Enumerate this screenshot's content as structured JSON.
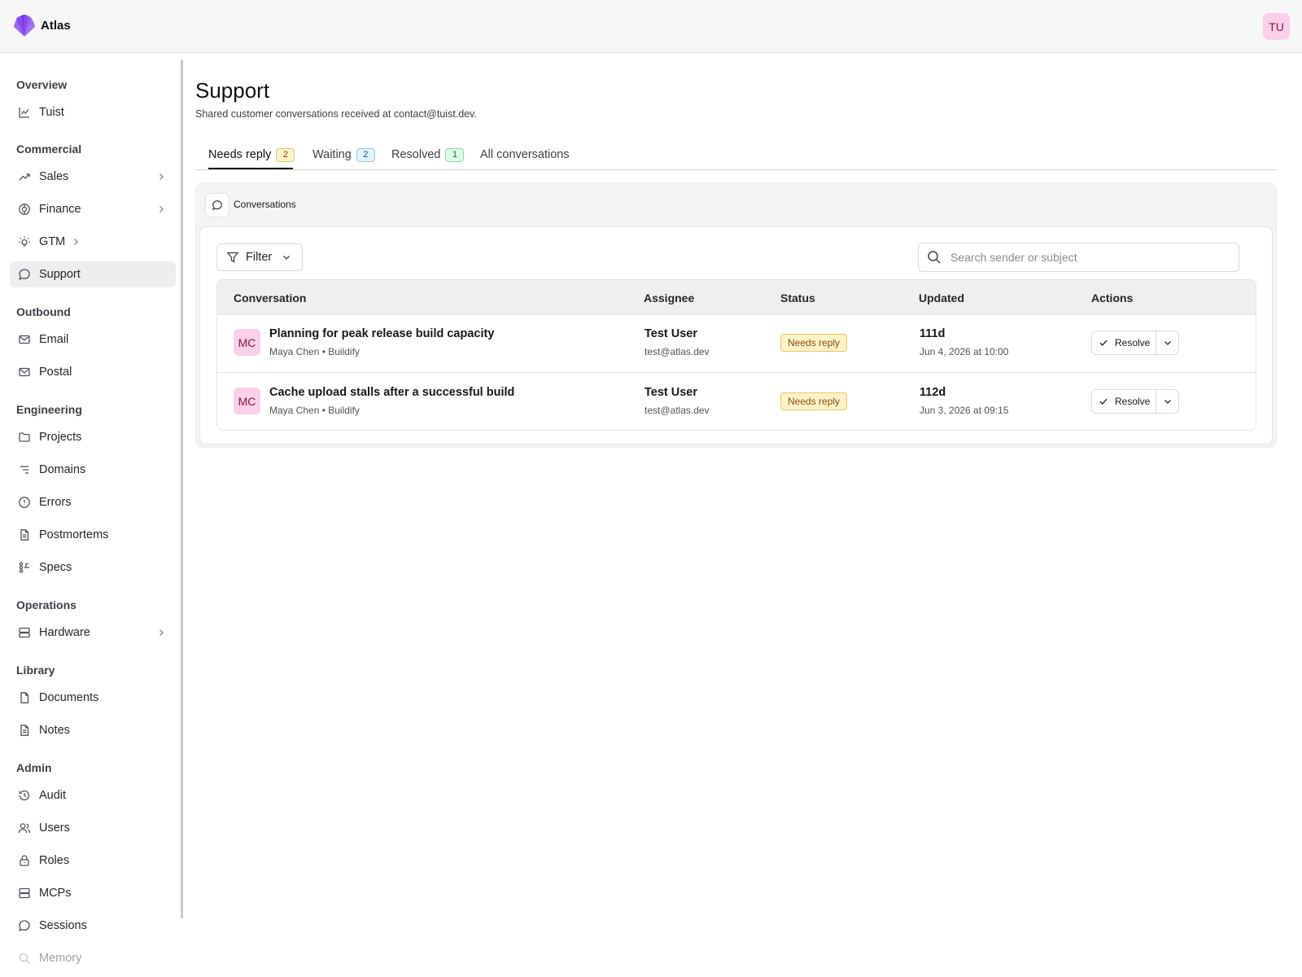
{
  "app": {
    "brand": "Atlas",
    "user_initials": "TU"
  },
  "sidebar": {
    "sections": [
      {
        "title": "Overview",
        "items": [
          {
            "label": "Tuist",
            "icon": "chart-icon"
          }
        ]
      },
      {
        "title": "Commercial",
        "items": [
          {
            "label": "Sales",
            "icon": "trending-up-icon",
            "expandable": true
          },
          {
            "label": "Finance",
            "icon": "coins-icon",
            "expandable": true
          },
          {
            "label": "GTM",
            "icon": "lightbulb-icon",
            "expandable": true
          },
          {
            "label": "Support",
            "icon": "message-circle-icon",
            "active": true
          }
        ]
      },
      {
        "title": "Outbound",
        "items": [
          {
            "label": "Email",
            "icon": "mail-icon"
          },
          {
            "label": "Postal",
            "icon": "mail-icon"
          }
        ]
      },
      {
        "title": "Engineering",
        "items": [
          {
            "label": "Projects",
            "icon": "folder-icon"
          },
          {
            "label": "Domains",
            "icon": "list-tree-icon"
          },
          {
            "label": "Errors",
            "icon": "alert-circle-icon"
          },
          {
            "label": "Postmortems",
            "icon": "file-text-icon"
          },
          {
            "label": "Specs",
            "icon": "workflow-icon"
          }
        ]
      },
      {
        "title": "Operations",
        "items": [
          {
            "label": "Hardware",
            "icon": "server-icon",
            "expandable": true
          }
        ]
      },
      {
        "title": "Library",
        "items": [
          {
            "label": "Documents",
            "icon": "file-icon"
          },
          {
            "label": "Notes",
            "icon": "file-text-icon"
          }
        ]
      },
      {
        "title": "Admin",
        "items": [
          {
            "label": "Audit",
            "icon": "history-icon"
          },
          {
            "label": "Users",
            "icon": "users-icon"
          },
          {
            "label": "Roles",
            "icon": "lock-icon"
          },
          {
            "label": "MCPs",
            "icon": "server-icon"
          },
          {
            "label": "Sessions",
            "icon": "message-circle-icon"
          },
          {
            "label": "Memory",
            "icon": "search-icon"
          }
        ]
      }
    ]
  },
  "page": {
    "title": "Support",
    "subtitle": "Shared customer conversations received at contact@tuist.dev."
  },
  "tabs": [
    {
      "label": "Needs reply",
      "count": "2",
      "active": true
    },
    {
      "label": "Waiting",
      "count": "2"
    },
    {
      "label": "Resolved",
      "count": "1"
    },
    {
      "label": "All conversations"
    }
  ],
  "panel": {
    "title": "Conversations"
  },
  "toolbar": {
    "filter_label": "Filter",
    "search_placeholder": "Search sender or subject"
  },
  "table": {
    "columns": [
      "Conversation",
      "Assignee",
      "Status",
      "Updated",
      "Actions"
    ],
    "rows": [
      {
        "initials": "MC",
        "subject": "Planning for peak release build capacity",
        "sender": "Maya Chen",
        "company": "Buildify",
        "meta": "Maya Chen • Buildify",
        "assignee_name": "Test User",
        "assignee_email": "test@atlas.dev",
        "status": "Needs reply",
        "updated_relative": "111d",
        "updated_absolute": "Jun 4, 2026 at 10:00",
        "action_label": "Resolve"
      },
      {
        "initials": "MC",
        "subject": "Cache upload stalls after a successful build",
        "sender": "Maya Chen",
        "company": "Buildify",
        "meta": "Maya Chen • Buildify",
        "assignee_name": "Test User",
        "assignee_email": "test@atlas.dev",
        "status": "Needs reply",
        "updated_relative": "112d",
        "updated_absolute": "Jun 3, 2026 at 09:15",
        "action_label": "Resolve"
      }
    ]
  },
  "colors": {
    "accent": "#7c3aed",
    "avatar_bg": "#fbcfe8",
    "status_needs_reply": "#fef3c7",
    "badge_waiting": "#e0f2fe",
    "badge_resolved": "#dcfce7"
  }
}
